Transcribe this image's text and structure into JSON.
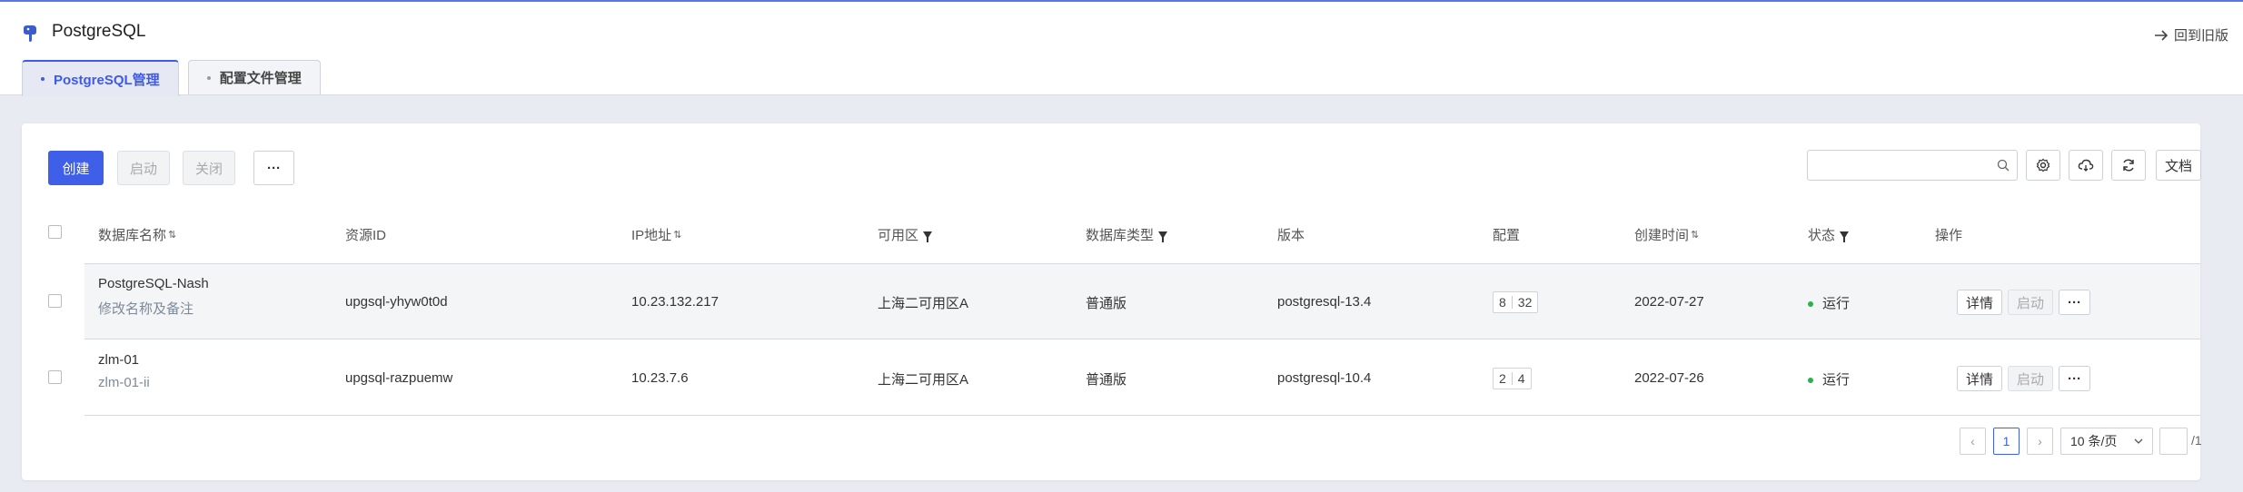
{
  "app": {
    "title": "PostgreSQL",
    "back_label": "回到旧版"
  },
  "tabs": [
    {
      "label": "PostgreSQL管理"
    },
    {
      "label": "配置文件管理"
    }
  ],
  "toolbar": {
    "create_label": "创建",
    "start_label": "启动",
    "stop_label": "关闭",
    "more_label": "···",
    "search_placeholder": "",
    "doc_label": "文档"
  },
  "table": {
    "columns": [
      "数据库名称",
      "资源ID",
      "IP地址",
      "可用区",
      "数据库类型",
      "版本",
      "配置",
      "创建时间",
      "状态",
      "操作"
    ],
    "rows": [
      {
        "name": "PostgreSQL-Nash",
        "remark": "修改名称及备注",
        "resource_id": "upgsql-yhyw0t0d",
        "ip": "10.23.132.217",
        "zone": "上海二可用区A",
        "db_type": "普通版",
        "version": "postgresql-13.4",
        "cpu": "8",
        "mem": "32",
        "created": "2022-07-27",
        "status": "运行"
      },
      {
        "name": "zlm-01",
        "remark": "zlm-01-ii",
        "resource_id": "upgsql-razpuemw",
        "ip": "10.23.7.6",
        "zone": "上海二可用区A",
        "db_type": "普通版",
        "version": "postgresql-10.4",
        "cpu": "2",
        "mem": "4",
        "created": "2022-07-26",
        "status": "运行"
      }
    ],
    "actions": {
      "detail": "详情",
      "start": "启动",
      "more": "···"
    }
  },
  "pagination": {
    "prev": "‹",
    "current": "1",
    "next": "›",
    "page_size": "10 条/页",
    "jump_value": "",
    "total_pages": "/1"
  },
  "colors": {
    "accent": "#3f5fe8",
    "status_running": "#27b24a"
  }
}
